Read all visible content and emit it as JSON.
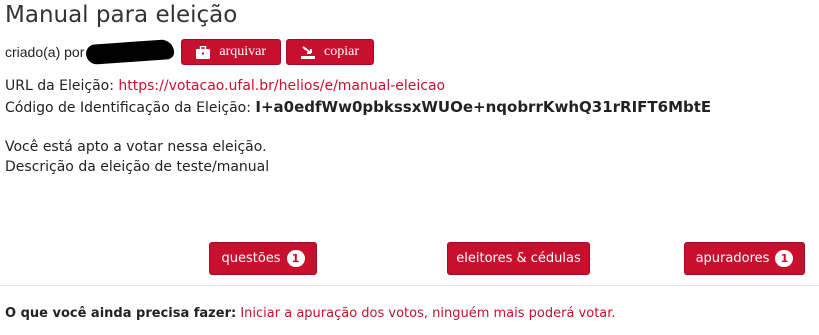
{
  "page": {
    "title": "Manual para eleição"
  },
  "creator": {
    "label": "criado(a) por",
    "archive_label": "arquivar",
    "copy_label": "copiar"
  },
  "election": {
    "url_label": "URL da Eleição:",
    "url": "https://votacao.ufal.br/helios/e/manual-eleicao",
    "code_label": "Código de Identificação da Eleição:",
    "code": "I+a0edfWw0pbkssxWUOe+nqobrrKwhQ31rRIFT6MbtE"
  },
  "status": {
    "eligible_text": "Você está apto a votar nessa eleição.",
    "description": "Descrição da eleição de teste/manual"
  },
  "nav": {
    "questions_label": "questões",
    "questions_count": "1",
    "voters_label": "eleitores & cédulas",
    "trustees_label": "apuradores",
    "trustees_count": "1"
  },
  "todo": {
    "label": "O que você ainda precisa fazer:",
    "action": "Iniciar a apuração dos votos, ninguém mais poderá votar."
  },
  "colors": {
    "accent": "#c8102e"
  }
}
